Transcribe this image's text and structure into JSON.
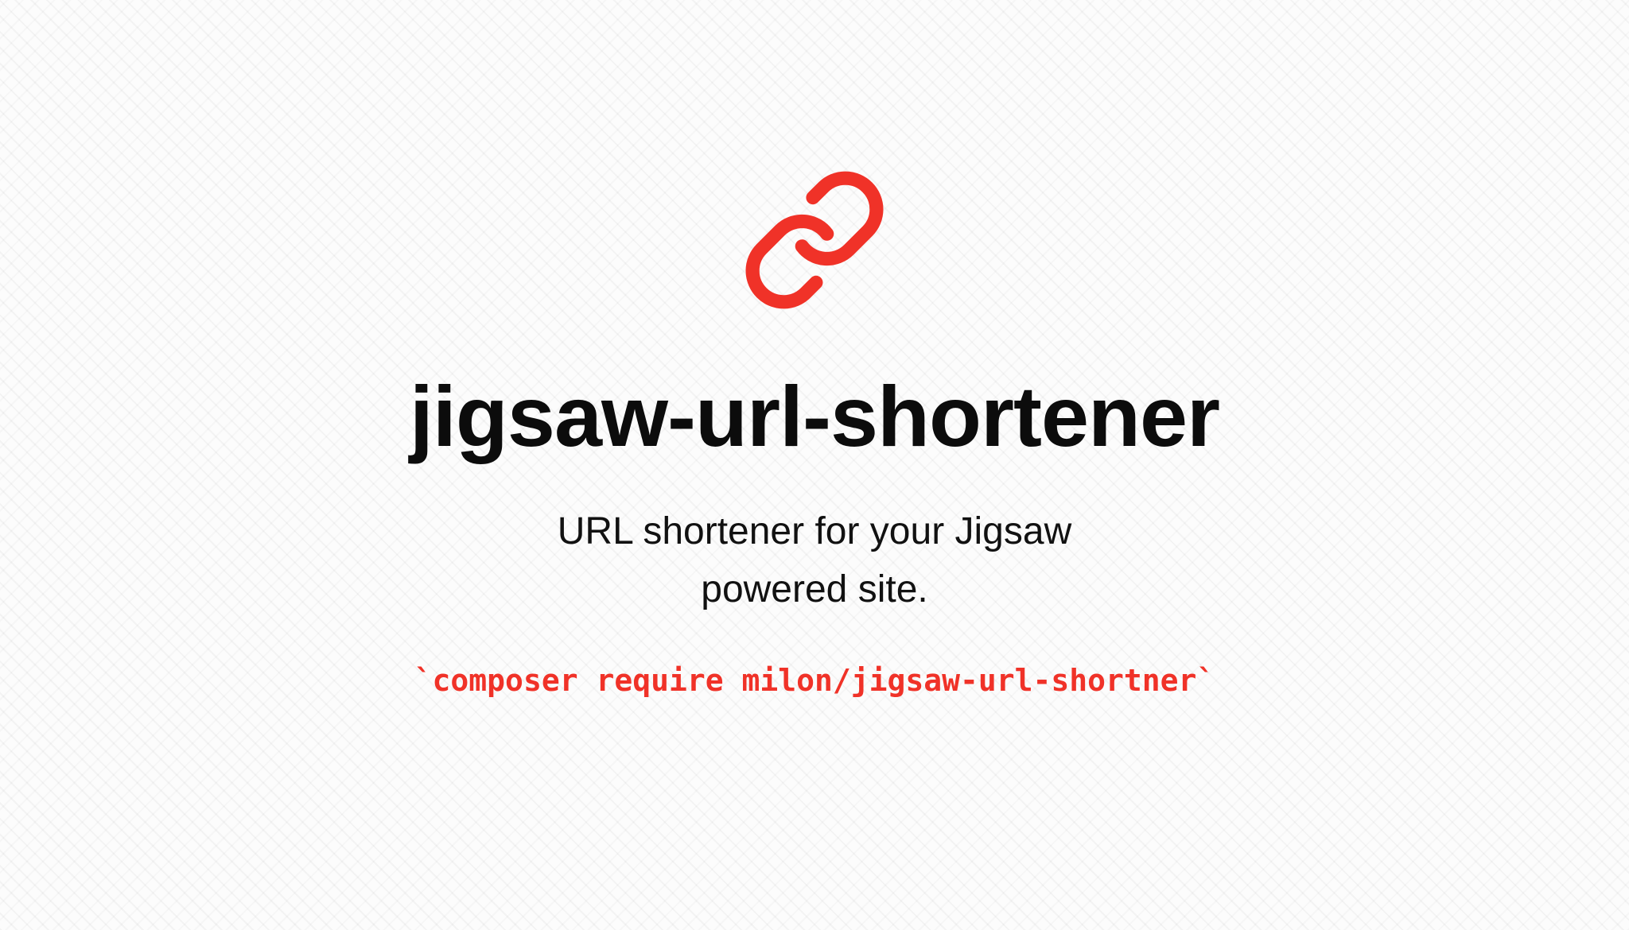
{
  "brand": {
    "accent_color": "#f03228",
    "logo_icon": "link-chain-icon"
  },
  "hero": {
    "title": "jigsaw-url-shortener",
    "tagline": "URL shortener for your Jigsaw powered site.",
    "install_command": "`composer require milon/jigsaw-url-shortner`"
  }
}
